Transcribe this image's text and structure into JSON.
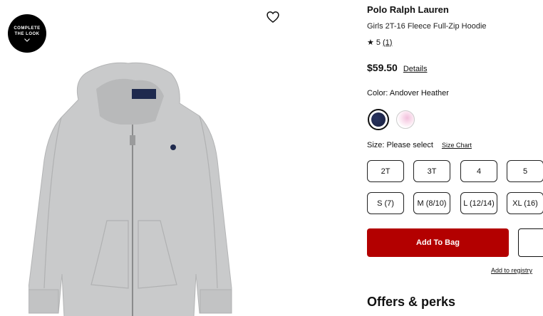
{
  "complete_look": {
    "line1": "COMPLETE",
    "line2": "THE LOOK"
  },
  "product": {
    "brand": "Polo Ralph Lauren",
    "name": "Girls 2T-16 Fleece Full-Zip Hoodie",
    "rating": "5",
    "review_count": "(1)",
    "price": "$59.50",
    "details_link": "Details"
  },
  "color": {
    "label": "Color: Andover Heather",
    "swatches": [
      {
        "name": "navy",
        "hex": "#1f2a4e",
        "selected": true
      },
      {
        "name": "pink",
        "hex": "#f2c0dc",
        "selected": false
      }
    ]
  },
  "size": {
    "label": "Size: Please select",
    "chart_link": "Size Chart",
    "options": [
      "2T",
      "3T",
      "4",
      "5",
      "S (7)",
      "M (8/10)",
      "L (12/14)",
      "XL (16)"
    ]
  },
  "actions": {
    "add_to_bag": "Add To Bag",
    "add_to_registry": "Add to registry"
  },
  "offers": {
    "heading": "Offers & perks"
  },
  "colors": {
    "brand_red": "#b30000"
  },
  "icons": [
    "heart-icon",
    "chevron-down-icon",
    "star-icon"
  ]
}
